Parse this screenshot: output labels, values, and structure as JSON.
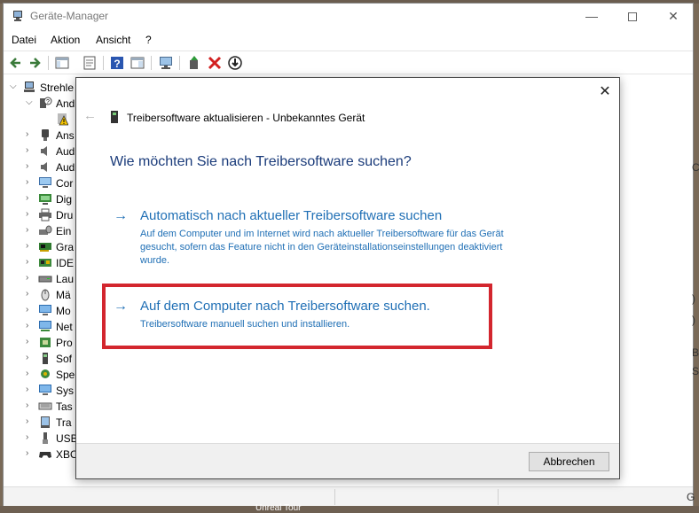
{
  "window": {
    "title": "Geräte-Manager",
    "minimize": "—",
    "close": "✕"
  },
  "menu": [
    "Datei",
    "Aktion",
    "Ansicht",
    "?"
  ],
  "tree": {
    "root": "Strehle",
    "items": [
      {
        "label": "And",
        "icon": "unknown-device-icon"
      },
      {
        "label": "",
        "icon": "warning-device-icon"
      },
      {
        "label": "Ans",
        "icon": "audio-input-icon"
      },
      {
        "label": "Aud",
        "icon": "speaker-icon"
      },
      {
        "label": "Aud",
        "icon": "speaker-icon"
      },
      {
        "label": "Cor",
        "icon": "computer-icon"
      },
      {
        "label": "Dig",
        "icon": "digital-tv-icon"
      },
      {
        "label": "Dru",
        "icon": "printer-icon"
      },
      {
        "label": "Ein",
        "icon": "input-device-icon"
      },
      {
        "label": "Gra",
        "icon": "graphics-card-icon"
      },
      {
        "label": "IDE",
        "icon": "ide-controller-icon"
      },
      {
        "label": "Lau",
        "icon": "drive-icon"
      },
      {
        "label": "Mä",
        "icon": "mouse-icon"
      },
      {
        "label": "Mo",
        "icon": "monitor-icon"
      },
      {
        "label": "Net",
        "icon": "network-adapter-icon"
      },
      {
        "label": "Pro",
        "icon": "processor-icon"
      },
      {
        "label": "Sof",
        "icon": "software-device-icon"
      },
      {
        "label": "Spe",
        "icon": "storage-controller-icon"
      },
      {
        "label": "Sys",
        "icon": "system-device-icon"
      },
      {
        "label": "Tas",
        "icon": "keyboard-icon"
      },
      {
        "label": "Tra",
        "icon": "portable-device-icon"
      },
      {
        "label": "USB",
        "icon": "usb-icon"
      },
      {
        "label": "XBO",
        "icon": "gamepad-icon"
      }
    ]
  },
  "right_edge": [
    {
      "text": "C"
    },
    {
      "text": ")"
    },
    {
      "text": ")"
    },
    {
      "text": "B"
    },
    {
      "text": "S"
    },
    {
      "text": "G"
    }
  ],
  "taskbar": {
    "label": "Unreal Tour"
  },
  "dialog": {
    "close": "✕",
    "back": "←",
    "header_title": "Treibersoftware aktualisieren - Unbekanntes Gerät",
    "question": "Wie möchten Sie nach Treibersoftware suchen?",
    "option_auto": {
      "arrow": "→",
      "title": "Automatisch nach aktueller Treibersoftware suchen",
      "description": "Auf dem Computer und im Internet wird nach aktueller Treibersoftware für das Gerät gesucht, sofern das Feature nicht in den Geräteinstallationseinstellungen deaktiviert wurde."
    },
    "option_manual": {
      "arrow": "→",
      "title": "Auf dem Computer nach Treibersoftware suchen.",
      "description": "Treibersoftware manuell suchen und installieren."
    },
    "cancel_label": "Abbrechen"
  },
  "colors": {
    "link_blue": "#1f6fb5",
    "question_blue": "#1a3b7a",
    "highlight_red": "#d3262e"
  }
}
